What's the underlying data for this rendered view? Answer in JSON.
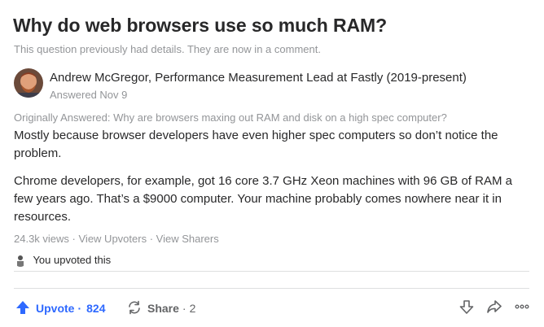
{
  "question": {
    "title": "Why do web browsers use so much RAM?",
    "details_note": "This question previously had details. They are now in a comment."
  },
  "answer": {
    "author": "Andrew McGregor, Performance Measurement Lead at Fastly (2019-present)",
    "answered_date": "Answered Nov 9",
    "originally_answered": "Originally Answered: Why are browsers maxing out RAM and disk on a high spec computer?",
    "paragraphs": [
      "Mostly because browser developers have even higher spec computers so don’t notice the problem.",
      "Chrome developers, for example, got 16 core 3.7 GHz Xeon machines with 96 GB of RAM a few years ago. That’s a $9000 computer. Your machine probably comes nowhere near it in resources."
    ],
    "views": "24.3k views",
    "view_upvoters": "View Upvoters",
    "view_sharers": "View Sharers",
    "you_upvoted": "You upvoted this"
  },
  "actions": {
    "upvote_label": "Upvote",
    "upvote_count": "824",
    "share_label": "Share",
    "share_count": "2"
  },
  "icons": {
    "upvote": "arrow-up-icon",
    "share": "share-cycle-icon",
    "downvote": "arrow-down-icon",
    "forward": "forward-icon",
    "more": "more-dots-icon"
  },
  "colors": {
    "accent": "#2e69ff",
    "text": "#282829",
    "muted": "#939598"
  }
}
